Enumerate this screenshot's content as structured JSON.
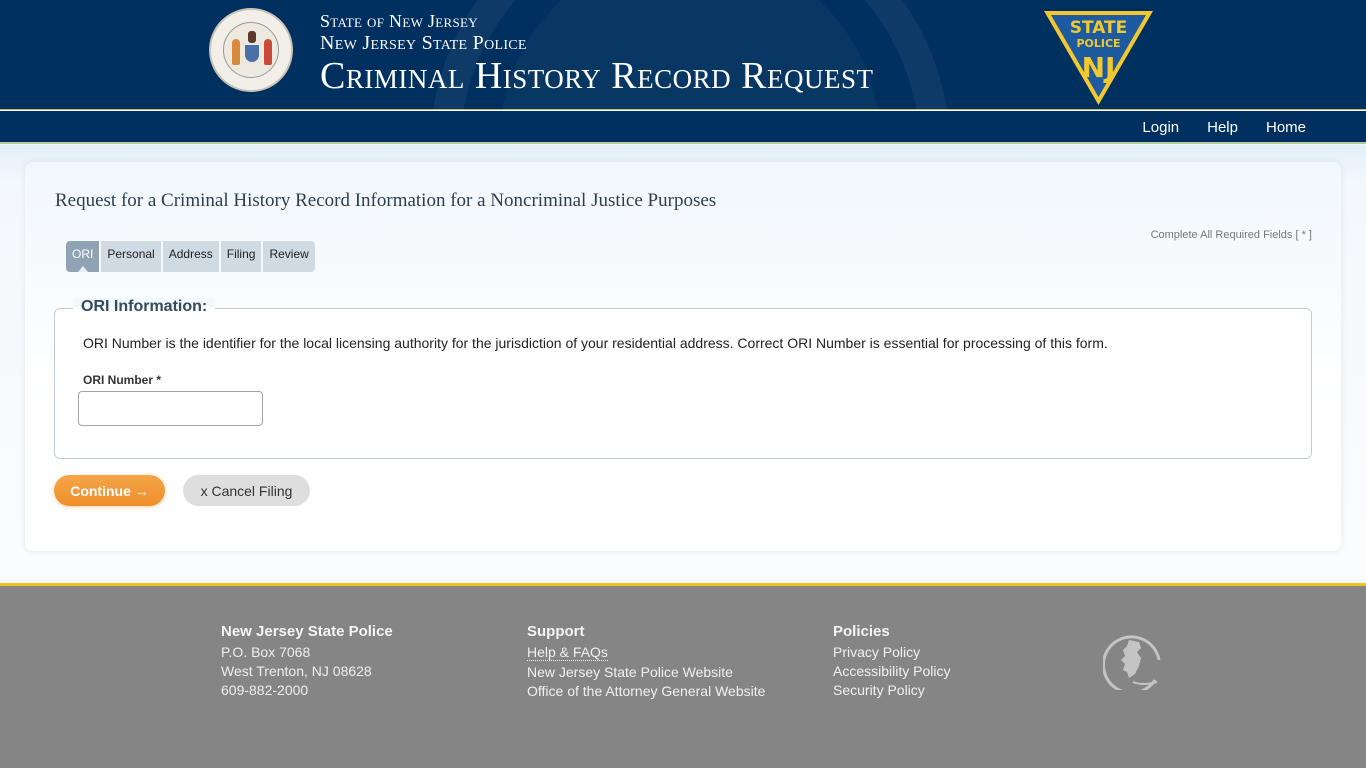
{
  "header": {
    "line1": "State of New Jersey",
    "line2": "New Jersey State Police",
    "title": "Criminal History Record Request",
    "seal_icon": "nj-state-seal",
    "badge_icon": "state-police-nj-badge",
    "badge_text_top": "STATE",
    "badge_text_mid": "POLICE",
    "badge_text_bottom": "NJ"
  },
  "nav": {
    "items": [
      {
        "label": "Login"
      },
      {
        "label": "Help"
      },
      {
        "label": "Home"
      }
    ]
  },
  "main": {
    "heading": "Request for a Criminal History Record Information for a Noncriminal Justice Purposes",
    "required_note": "Complete All Required Fields [ * ]",
    "tabs": [
      {
        "label": "ORI",
        "active": true
      },
      {
        "label": "Personal",
        "active": false
      },
      {
        "label": "Address",
        "active": false
      },
      {
        "label": "Filing",
        "active": false
      },
      {
        "label": "Review",
        "active": false
      }
    ],
    "section": {
      "legend": "ORI Information:",
      "description": "ORI Number is the identifier for the local licensing authority for the jurisdiction of your residential address. Correct ORI Number is essential for processing of this form.",
      "field_label": "ORI Number *",
      "field_value": "",
      "field_placeholder": ""
    },
    "buttons": {
      "continue": "Continue →",
      "cancel": "x Cancel Filing"
    }
  },
  "footer": {
    "org": {
      "title": "New Jersey State Police",
      "lines": [
        "P.O. Box 7068",
        "West Trenton, NJ 08628",
        "609-882-2000"
      ]
    },
    "support": {
      "title": "Support",
      "links": [
        "Help & FAQs",
        "New Jersey State Police Website",
        "Office of the Attorney General Website"
      ]
    },
    "policies": {
      "title": "Policies",
      "links": [
        "Privacy Policy",
        "Accessibility Policy",
        "Security Policy"
      ]
    },
    "logo_icon": "nj-state-outline-logo"
  },
  "colors": {
    "header_bg": "#00305f",
    "accent_gold": "#e8c81c",
    "continue_button": "#ef8e2a",
    "active_tab": "#8fa3b4",
    "footer_bg": "#858585"
  }
}
